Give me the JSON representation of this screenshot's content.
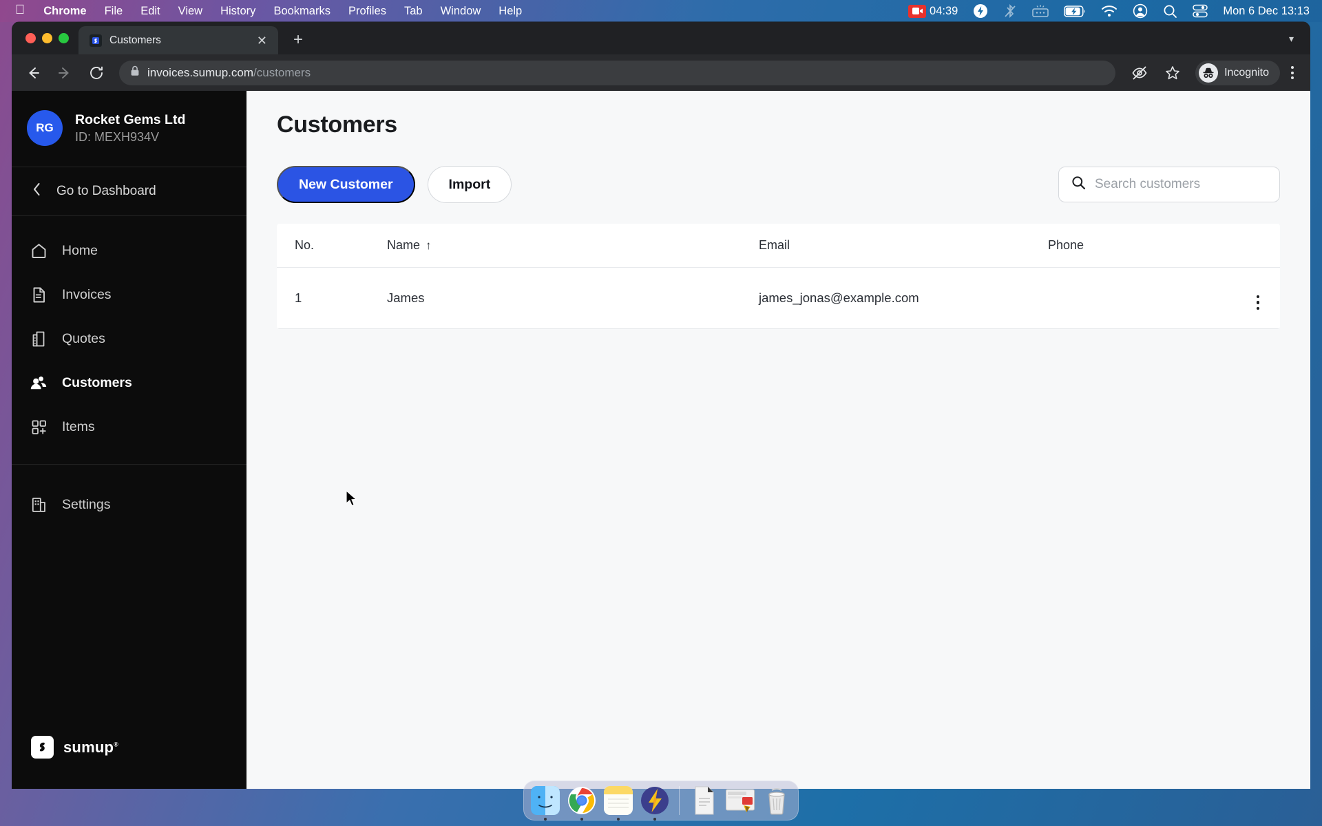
{
  "menubar": {
    "apple_icon": "apple-logo-icon",
    "items": [
      {
        "label": "Chrome",
        "bold": true
      },
      {
        "label": "File",
        "bold": false
      },
      {
        "label": "Edit",
        "bold": false
      },
      {
        "label": "View",
        "bold": false
      },
      {
        "label": "History",
        "bold": false
      },
      {
        "label": "Bookmarks",
        "bold": false
      },
      {
        "label": "Profiles",
        "bold": false
      },
      {
        "label": "Tab",
        "bold": false
      },
      {
        "label": "Window",
        "bold": false
      },
      {
        "label": "Help",
        "bold": false
      }
    ],
    "recording_time": "04:39",
    "status_icons": [
      "screen-recording-icon",
      "flash-bolt-icon",
      "bluetooth-off-icon",
      "keyboard-brightness-icon",
      "battery-charging-icon",
      "wifi-icon",
      "user-account-icon",
      "search-icon",
      "control-center-icon"
    ],
    "clock": "Mon 6 Dec  13:13"
  },
  "browser": {
    "tab": {
      "title": "Customers",
      "favicon": "sumup-favicon-icon",
      "close_icon": "close-icon"
    },
    "new_tab_icon": "plus-icon",
    "tab_list_icon": "chevron-down-icon",
    "nav": {
      "back_icon": "back-arrow-icon",
      "forward_icon": "forward-arrow-icon",
      "reload_icon": "reload-icon"
    },
    "omnibox": {
      "lock_icon": "lock-icon",
      "domain": "invoices.sumup.com",
      "path": "/customers"
    },
    "toolbar_right": {
      "third_party_cookies_icon": "eye-slash-icon",
      "bookmark_icon": "star-icon",
      "profile_icon": "incognito-icon",
      "profile_label": "Incognito",
      "menu_icon": "kebab-menu-icon"
    }
  },
  "sidebar": {
    "org": {
      "initials": "RG",
      "name": "Rocket Gems Ltd",
      "id": "ID: MEXH934V",
      "avatar_color": "#2759ec"
    },
    "go_to_dashboard": {
      "label": "Go to Dashboard",
      "icon": "chevron-left-icon"
    },
    "items": [
      {
        "label": "Home",
        "icon": "home-icon",
        "active": false
      },
      {
        "label": "Invoices",
        "icon": "document-icon",
        "active": false
      },
      {
        "label": "Quotes",
        "icon": "quote-document-icon",
        "active": false
      },
      {
        "label": "Customers",
        "icon": "people-icon",
        "active": true
      },
      {
        "label": "Items",
        "icon": "grid-plus-icon",
        "active": false
      }
    ],
    "bottom_items": [
      {
        "label": "Settings",
        "icon": "building-icon",
        "active": false
      }
    ],
    "brand": {
      "mark_icon": "sumup-logo-icon",
      "word": "sumup",
      "registered": "®"
    }
  },
  "main": {
    "page_title": "Customers",
    "buttons": {
      "new_customer": "New Customer",
      "import": "Import"
    },
    "search": {
      "placeholder": "Search customers",
      "value": "",
      "icon": "search-icon"
    },
    "table": {
      "columns": [
        "No.",
        "Name",
        "Email",
        "Phone"
      ],
      "sorted_column": "Name",
      "sort_direction": "ascending",
      "sort_icon": "arrow-up-icon",
      "row_menu_icon": "kebab-menu-icon",
      "rows": [
        {
          "no": "1",
          "name": "James",
          "email": "james_jonas@example.com",
          "phone": ""
        }
      ]
    }
  },
  "colors": {
    "accent": "#2b54e4",
    "sidebar_bg": "#0c0c0c",
    "page_bg": "#f7f8f9",
    "card_bg": "#ffffff"
  },
  "dock": {
    "apps": [
      {
        "name": "finder-icon",
        "running": true
      },
      {
        "name": "chrome-icon",
        "running": true
      },
      {
        "name": "notes-icon",
        "running": true
      },
      {
        "name": "thunder-app-icon",
        "running": true
      }
    ],
    "files": [
      {
        "name": "document-file-icon"
      },
      {
        "name": "screenshot-file-icon"
      }
    ],
    "trash": {
      "name": "trash-icon"
    }
  }
}
